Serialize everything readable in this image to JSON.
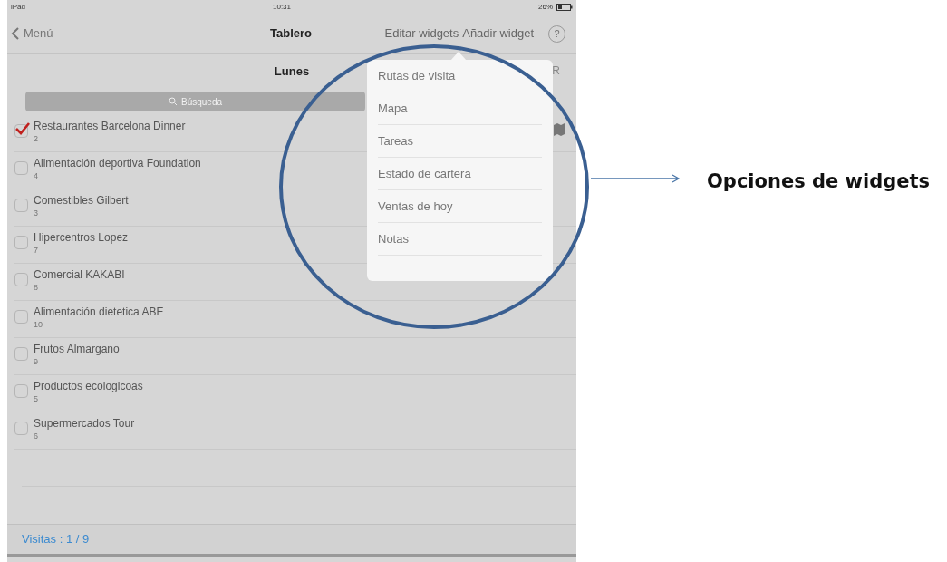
{
  "status_bar": {
    "device": "iPad",
    "time": "10:31",
    "battery": "26%"
  },
  "nav": {
    "back": "Menú",
    "title": "Tablero",
    "actions": [
      "Editar widgets",
      "Añadir widget"
    ],
    "help": "?"
  },
  "header": {
    "title": "Lunes",
    "right": "R"
  },
  "search": {
    "placeholder": "Búsqueda"
  },
  "visits": [
    {
      "name": "Restaurantes Barcelona Dinner",
      "number": "2",
      "checked": true
    },
    {
      "name": "Alimentación deportiva Foundation",
      "number": "4",
      "checked": false
    },
    {
      "name": "Comestibles Gilbert",
      "number": "3",
      "checked": false
    },
    {
      "name": "Hipercentros Lopez",
      "number": "7",
      "checked": false
    },
    {
      "name": "Comercial KAKABI",
      "number": "8",
      "checked": false
    },
    {
      "name": "Alimentación dietetica ABE",
      "number": "10",
      "checked": false
    },
    {
      "name": "Frutos Almargano",
      "number": "9",
      "checked": false
    },
    {
      "name": "Productos ecologicoas",
      "number": "5",
      "checked": false
    },
    {
      "name": "Supermercados Tour",
      "number": "6",
      "checked": false
    }
  ],
  "footer": "Visitas : 1 / 9",
  "popover": {
    "items": [
      "Rutas de visita",
      "Mapa",
      "Tareas",
      "Estado de cartera",
      "Ventas de hoy",
      "Notas"
    ]
  },
  "annotation": "Opciones de widgets"
}
